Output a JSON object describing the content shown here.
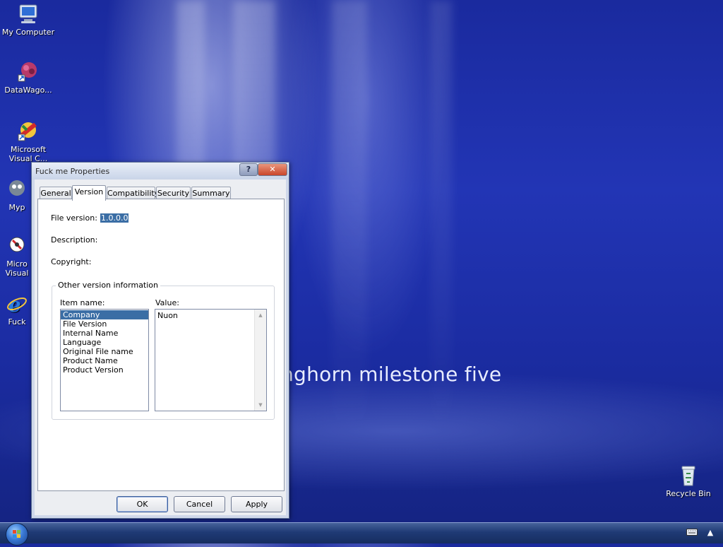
{
  "desktop": {
    "icons": [
      {
        "label": "My Computer",
        "icon": "computer-icon"
      },
      {
        "label": "DataWago...",
        "icon": "shortcut-icon"
      },
      {
        "label": "Microsoft Visual C...",
        "icon": "visual-studio-icon"
      },
      {
        "label": "Myp",
        "icon": "shortcut-icon"
      },
      {
        "label": "Micro Visual",
        "icon": "shortcut-icon"
      },
      {
        "label": "Fuck",
        "icon": "internet-explorer-icon"
      },
      {
        "label": "Recycle Bin",
        "icon": "recycle-bin-icon"
      }
    ],
    "wallpaper_text": "nghorn milestone five"
  },
  "dialog": {
    "title": "Fuck me Properties",
    "help_button": "?",
    "close_button": "✕",
    "tabs": [
      {
        "label": "General",
        "active": false
      },
      {
        "label": "Version",
        "active": true
      },
      {
        "label": "Compatibility",
        "active": false
      },
      {
        "label": "Security",
        "active": false
      },
      {
        "label": "Summary",
        "active": false
      }
    ],
    "version_tab": {
      "file_version_label": "File version:",
      "file_version_value": "1.0.0.0",
      "description_label": "Description:",
      "copyright_label": "Copyright:",
      "group_title": "Other version information",
      "item_name_label": "Item name:",
      "value_label": "Value:",
      "items": [
        "Company",
        "File Version",
        "Internal Name",
        "Language",
        "Original File name",
        "Product Name",
        "Product Version"
      ],
      "selected_item": "Company",
      "value_text": "Nuon"
    },
    "buttons": {
      "ok": "OK",
      "cancel": "Cancel",
      "apply": "Apply"
    }
  },
  "taskbar": {
    "start_icon": "start-orb-icon",
    "tray_icons": [
      "keyboard-icon",
      "chevron-up-icon"
    ]
  },
  "colors": {
    "selection": "#3b6ea5",
    "desktop_blue": "#2235b5"
  }
}
